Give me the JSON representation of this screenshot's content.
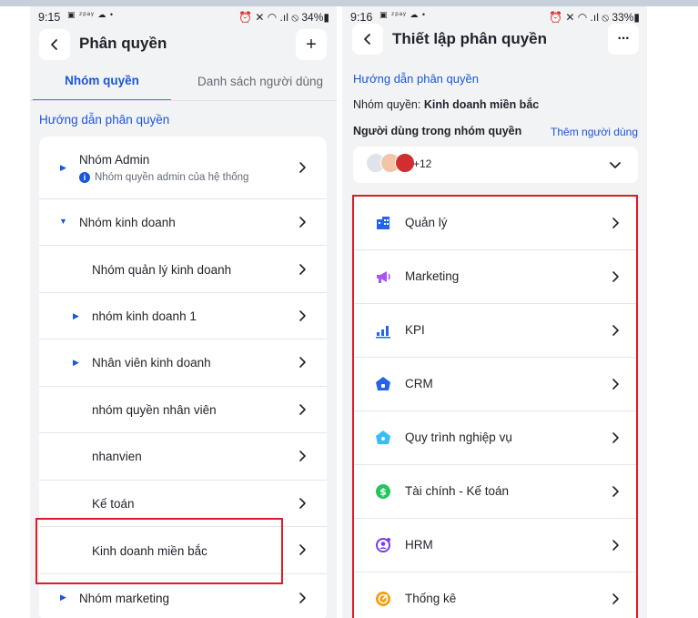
{
  "left_screen": {
    "status": {
      "time": "9:15",
      "glyphs": "▣ ᶻᵖᵃʸ ☁ •",
      "battery": "⏰ ✕ ◠ .ıl ⦸ 34%▮"
    },
    "header": {
      "title": "Phân quyền",
      "add_label": "+"
    },
    "tabs": [
      {
        "label": "Nhóm quyền",
        "active": true
      },
      {
        "label": "Danh sách người dùng",
        "active": false
      }
    ],
    "guide_link": "Hướng dẫn phân quyền",
    "groups": [
      {
        "label": "Nhóm Admin",
        "subtitle": "Nhóm quyền admin của hệ thống",
        "caret": "▶"
      },
      {
        "label": "Nhóm kinh doanh",
        "caret": "▼"
      },
      {
        "label": "Nhóm quản lý kinh doanh",
        "caret": ""
      },
      {
        "label": "nhóm kinh doanh 1",
        "caret": "▶"
      },
      {
        "label": "Nhân viên kinh doanh",
        "caret": "▶"
      },
      {
        "label": "nhóm quyền nhân viên",
        "caret": ""
      },
      {
        "label": "nhanvien",
        "caret": ""
      },
      {
        "label": "Kế toán",
        "caret": ""
      },
      {
        "label": "Kinh doanh miền bắc",
        "caret": ""
      },
      {
        "label": "Nhóm marketing",
        "caret": "▶"
      }
    ]
  },
  "right_screen": {
    "status": {
      "time": "9:16",
      "glyphs": "▣ ᶻᵖᵃʸ ☁ •",
      "battery": "⏰ ✕ ◠ .ıl ⦸ 33%▮"
    },
    "header": {
      "title": "Thiết lập phân quyền",
      "more_label": "···"
    },
    "guide_link": "Hướng dẫn phân quyền",
    "group_prefix": "Nhóm quyền: ",
    "group_name": "Kinh doanh miền bắc",
    "users_title": "Người dùng trong nhóm quyền",
    "add_user": "Thêm người dùng",
    "user_count": "+12",
    "modules": [
      {
        "label": "Quản lý",
        "icon": "building-icon",
        "color": "#2563eb"
      },
      {
        "label": "Marketing",
        "icon": "megaphone-icon",
        "color": "#a855f7"
      },
      {
        "label": "KPI",
        "icon": "bar-chart-icon",
        "color": "#2563eb"
      },
      {
        "label": "CRM",
        "icon": "crm-home-icon",
        "color": "#2563eb"
      },
      {
        "label": "Quy trình nghiệp vụ",
        "icon": "workflow-icon",
        "color": "#38bdf8"
      },
      {
        "label": "Tài chính - Kế toán",
        "icon": "dollar-icon",
        "color": "#22c55e"
      },
      {
        "label": "HRM",
        "icon": "hrm-icon",
        "color": "#7c3aed"
      },
      {
        "label": "Thống kê",
        "icon": "stats-icon",
        "color": "#f59e0b"
      }
    ]
  },
  "colors": {
    "accent": "#1a56db",
    "highlight": "#e01b24",
    "background": "#f2f3f5"
  }
}
